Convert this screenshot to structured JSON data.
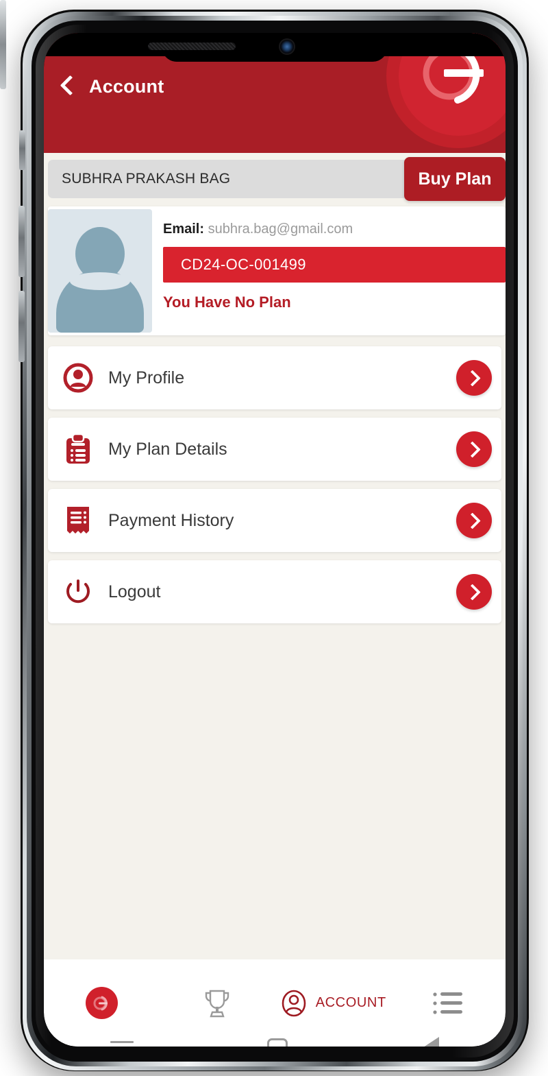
{
  "app": {
    "header": {
      "title": "Account",
      "back_icon": "chevron-left-icon",
      "logo_icon": "brand-logo-icon"
    },
    "colors": {
      "header_red": "#A91E26",
      "accent_red": "#D0202B",
      "id_bar_red": "#D9232E",
      "buy_plan_red": "#AD1D24",
      "page_background": "#F4F2EC",
      "name_bar_grey": "#DCDCDC",
      "avatar_bg": "#DCE5EB",
      "avatar_fill": "#84A6B6",
      "no_plan_text": "#B41C25",
      "nav_label": "#A81C24"
    }
  },
  "account": {
    "name": "SUBHRA PRAKASH BAG",
    "buy_plan_label": "Buy Plan",
    "email_label": "Email:",
    "email_value": "subhra.bag@gmail.com",
    "member_id": "CD24-OC-001499",
    "plan_status": "You Have No Plan",
    "avatar_icon": "user-avatar-placeholder-icon"
  },
  "menu": {
    "items": [
      {
        "label": "My Profile",
        "icon": "user-circle-icon",
        "chevron": "chevron-right-icon"
      },
      {
        "label": "My Plan Details",
        "icon": "clipboard-list-icon",
        "chevron": "chevron-right-icon"
      },
      {
        "label": "Payment History",
        "icon": "receipt-icon",
        "chevron": "chevron-right-icon"
      },
      {
        "label": "Logout",
        "icon": "power-icon",
        "chevron": "chevron-right-icon"
      }
    ]
  },
  "bottom_nav": {
    "items": [
      {
        "label": "",
        "icon": "brand-logo-icon"
      },
      {
        "label": "",
        "icon": "trophy-icon"
      },
      {
        "label": "ACCOUNT",
        "icon": "user-circle-outline-icon"
      },
      {
        "label": "",
        "icon": "list-menu-icon"
      }
    ]
  },
  "system_nav": {
    "recent_icon": "recent-apps-icon",
    "home_icon": "home-icon",
    "back_icon": "back-triangle-icon"
  }
}
